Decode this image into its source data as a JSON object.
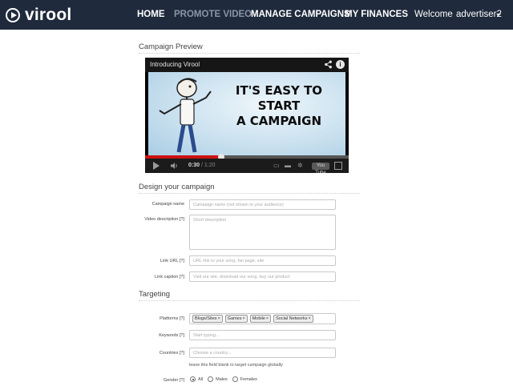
{
  "brand": {
    "name": "virool"
  },
  "nav": {
    "home": "HOME",
    "promote_video": "PROMOTE VIDEO",
    "manage_campaigns": "MANAGE CAMPAIGNS",
    "my_finances": "MY FINANCES",
    "welcome": "Welcome",
    "user": "advertiser2"
  },
  "preview": {
    "section_title": "Campaign Preview",
    "video_title": "Introducing Virool",
    "headline_line1": "IT'S EASY TO START",
    "headline_line2": "A CAMPAIGN",
    "time_current": "0:30",
    "time_total": "/ 1:20",
    "progress_fraction": 0.375,
    "yt_logo": "You Tube"
  },
  "design": {
    "section_title": "Design your campaign",
    "campaign_name_label": "Campaign name",
    "campaign_name_placeholder": "Campaign name (not shown to your audience)",
    "video_description_label": "Video description [?]",
    "video_description_placeholder": "Short description",
    "link_url_label": "Link URL [?]",
    "link_url_placeholder": "URL link to your song, fan page, site",
    "link_caption_label": "Link caption [?]",
    "link_caption_placeholder": "Visit our site, download our song, buy our product"
  },
  "targeting": {
    "section_title": "Targeting",
    "platforms_label": "Platforms [?]",
    "platforms": [
      "Blogs/Sites",
      "Games",
      "Mobile",
      "Social Networks"
    ],
    "keywords_label": "Keywords [?]",
    "keywords_placeholder": "Start typing...",
    "countries_label": "Countries [?]",
    "countries_placeholder": "Choose a country...",
    "countries_hint": "leave this field blank to target campaign globally",
    "gender_label": "Gender [?]",
    "gender_options": [
      "All",
      "Males",
      "Females"
    ],
    "gender_selected": "All"
  },
  "colors": {
    "nav_bg": "#1f2a3c",
    "nav_dim": "#8a96a8",
    "progress": "#cc1111"
  }
}
